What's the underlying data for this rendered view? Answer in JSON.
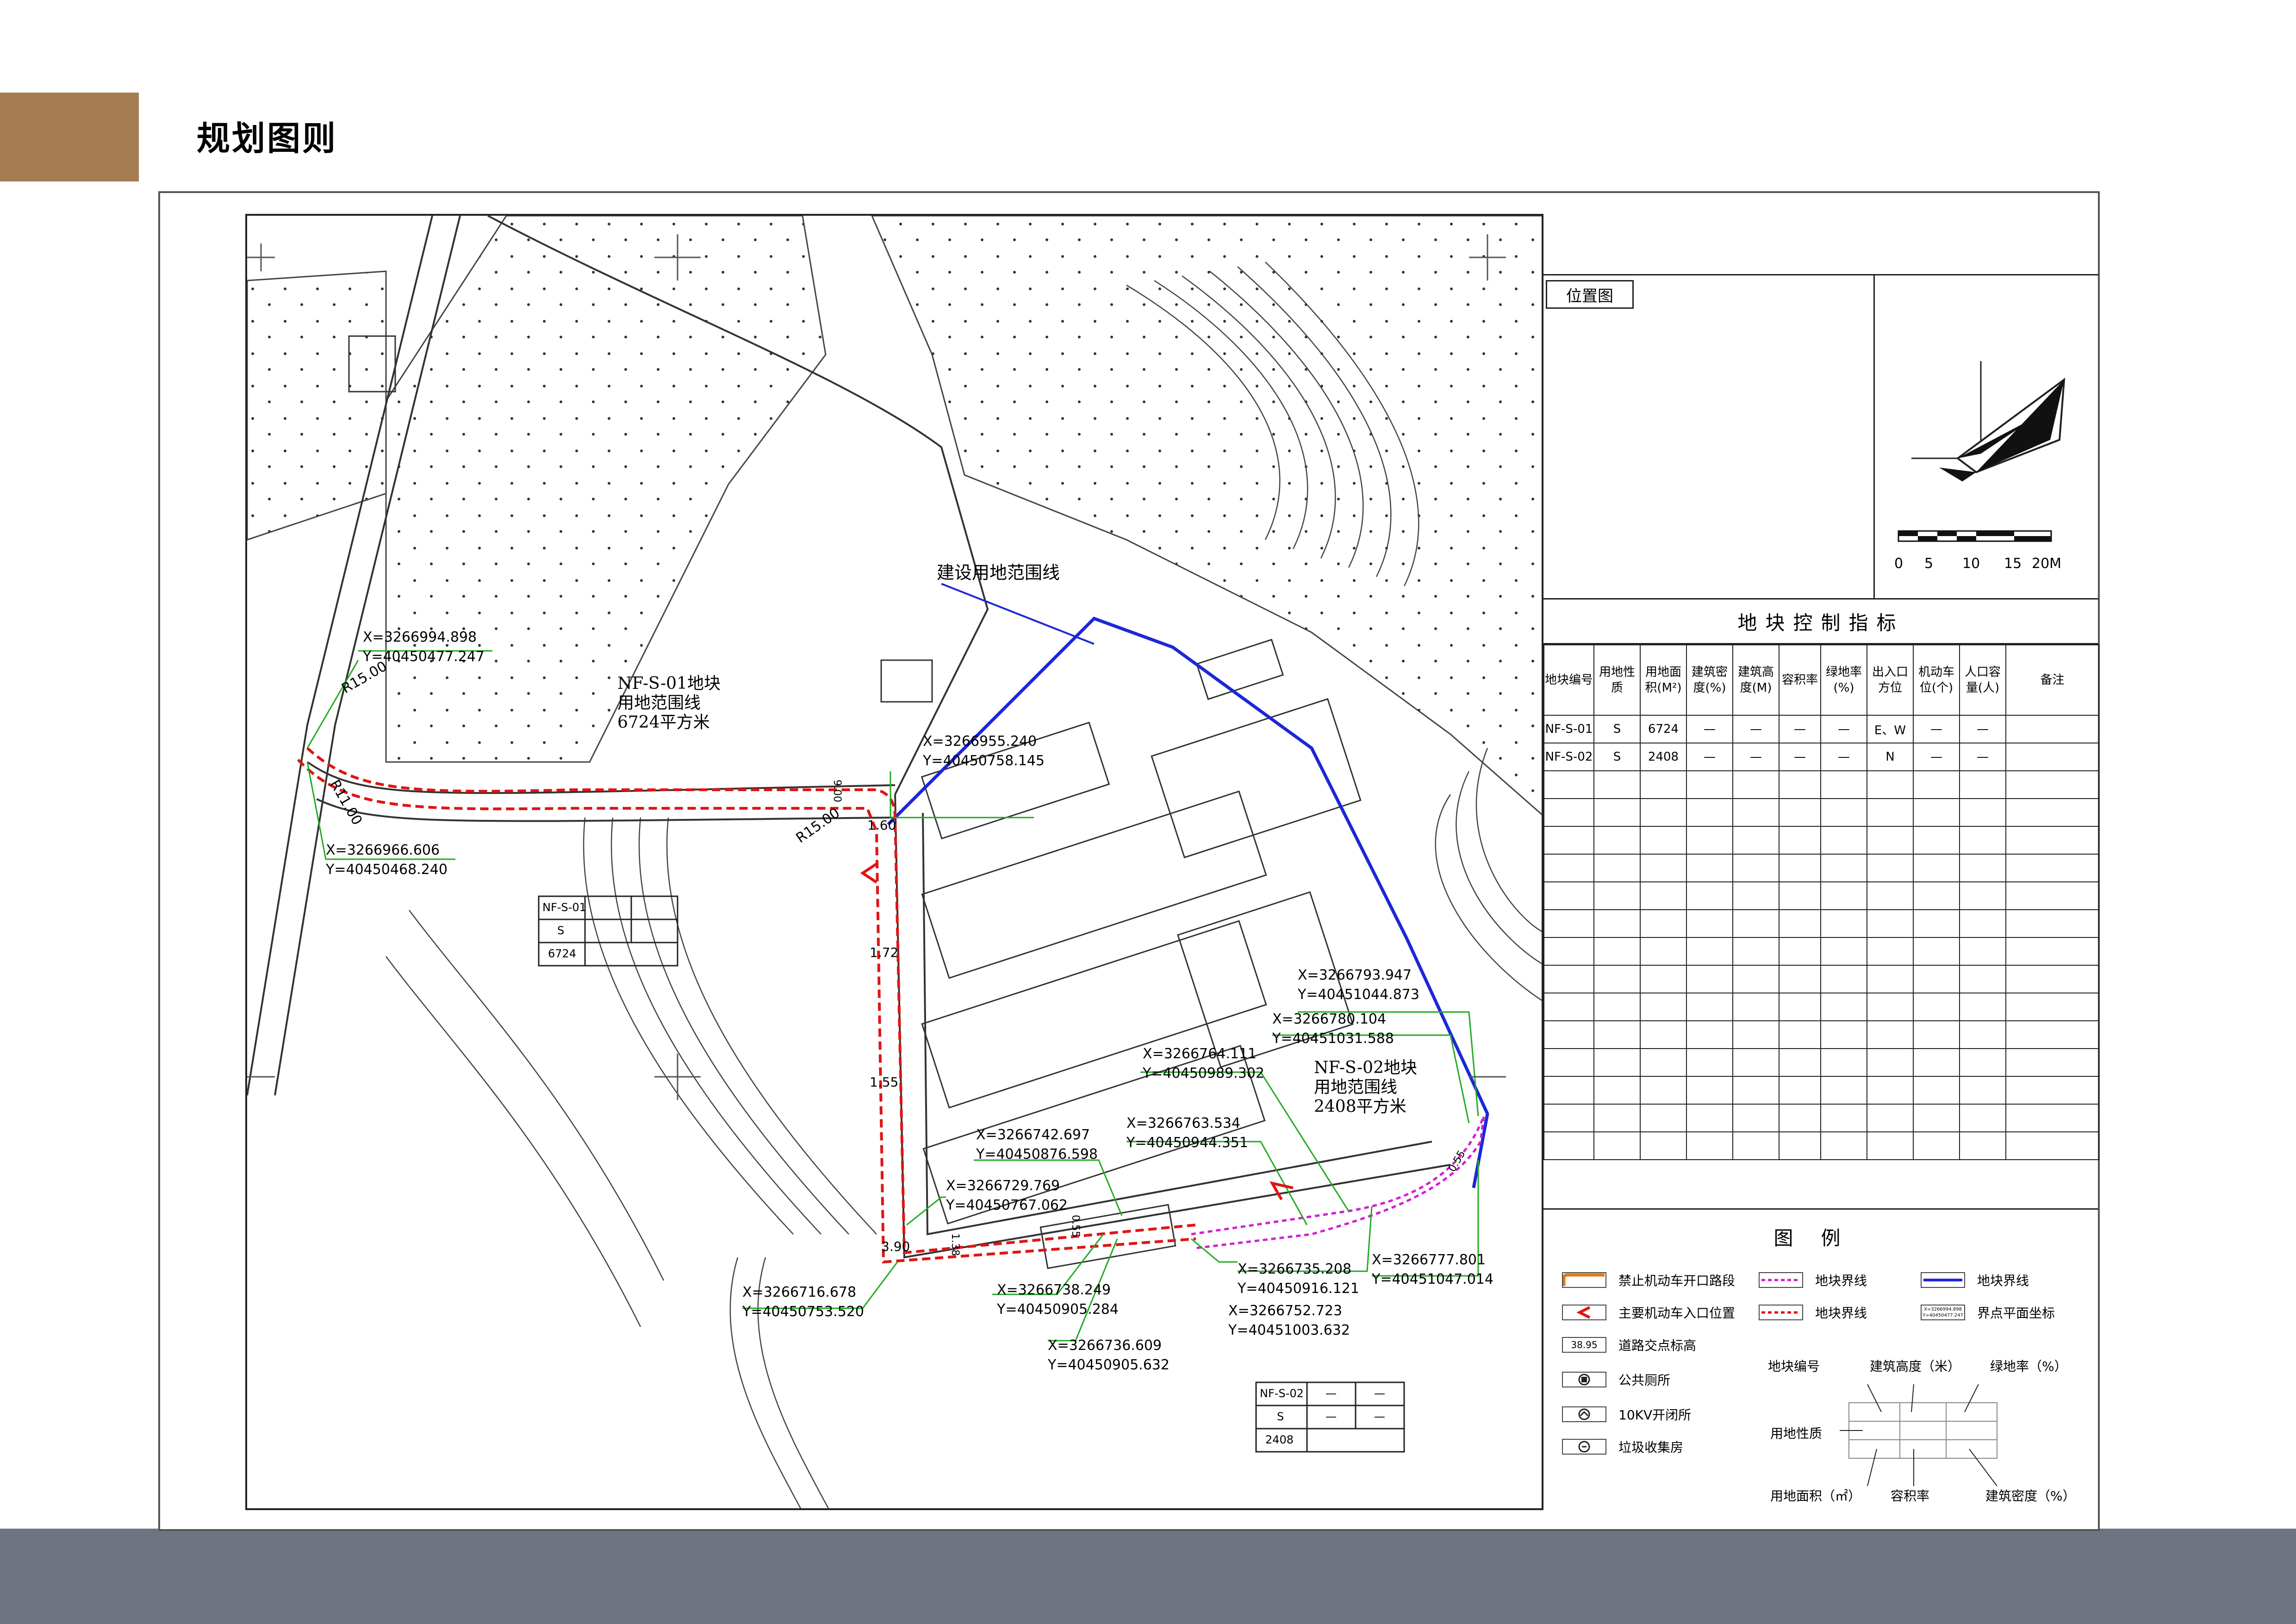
{
  "header": {
    "title": "规划图则"
  },
  "colors": {
    "brand": "#a57c52",
    "footer": "#6e7580",
    "boundary_blue": "#1c28d6",
    "boundary_red": "#e01414",
    "boundary_magenta": "#d020d0",
    "coord_green": "#22aa22"
  },
  "location_panel": {
    "label": "位置图",
    "scale_ticks": [
      "0",
      "5",
      "10",
      "15",
      "20M"
    ]
  },
  "control_table": {
    "title": "地块控制指标",
    "headers": [
      "地块编号",
      "用地性质",
      "用地面积(M²)",
      "建筑密度(%)",
      "建筑高度(M)",
      "容积率",
      "绿地率(%)",
      "出入口方位",
      "机动车位(个)",
      "人口容量(人)",
      "备注"
    ],
    "rows": [
      [
        "NF-S-01",
        "S",
        "6724",
        "—",
        "—",
        "—",
        "—",
        "E、W",
        "—",
        "—",
        ""
      ],
      [
        "NF-S-02",
        "S",
        "2408",
        "—",
        "—",
        "—",
        "—",
        "N",
        "—",
        "—",
        ""
      ]
    ],
    "empty_rows": 14
  },
  "legend": {
    "title": "图例",
    "items": {
      "no_entry": "禁止机动车开口路段",
      "main_entry": "主要机动车入口位置",
      "road_elev": "道路交点标高",
      "road_elev_sample": "38.95",
      "toilet": "公共厕所",
      "switch": "10KV开闭所",
      "garbage": "垃圾收集房",
      "plot_line_magenta": "地块界线",
      "plot_line_red": "地块界线",
      "plot_line_blue": "地块界线",
      "coord": "界点平面坐标",
      "coord_sample_x": "X=3266994.898",
      "coord_sample_y": "Y=40450477.247"
    },
    "key": {
      "plot_no": "地块编号",
      "height": "建筑高度（米）",
      "green": "绿地率（%）",
      "use": "用地性质",
      "area": "用地面积（㎡）",
      "far": "容积率",
      "density": "建筑密度（%）"
    }
  },
  "map": {
    "boundary_label_blue": "建设用地范围线",
    "plot1_label": [
      "NF-S-01地块",
      "用地范围线",
      "6724平方米"
    ],
    "plot2_label": [
      "NF-S-02地块",
      "用地范围线",
      "2408平方米"
    ],
    "radii": [
      "R15.00",
      "R11.00",
      "R15.00"
    ],
    "widths": [
      "1.60",
      "1.72",
      "1.55",
      "3.90",
      "1.38",
      "0.55",
      "0.55",
      "9.00"
    ],
    "coords": [
      [
        "X=3266994.898",
        "Y=40450477.247"
      ],
      [
        "X=3266966.606",
        "Y=40450468.240"
      ],
      [
        "X=3266955.240",
        "Y=40450758.145"
      ],
      [
        "X=3266793.947",
        "Y=40451044.873"
      ],
      [
        "X=3266780.104",
        "Y=40451031.588"
      ],
      [
        "X=3266764.111",
        "Y=40450989.302"
      ],
      [
        "X=3266763.534",
        "Y=40450944.351"
      ],
      [
        "X=3266742.697",
        "Y=40450876.598"
      ],
      [
        "X=3266729.769",
        "Y=40450767.062"
      ],
      [
        "X=3266716.678",
        "Y=40450753.520"
      ],
      [
        "X=3266738.249",
        "Y=40450905.284"
      ],
      [
        "X=3266736.609",
        "Y=40450905.632"
      ],
      [
        "X=3266735.208",
        "Y=40450916.121"
      ],
      [
        "X=3266752.723",
        "Y=40451003.632"
      ],
      [
        "X=3266777.801",
        "Y=40451047.014"
      ]
    ],
    "mini_table_1": [
      "NF-S-01",
      "S",
      "6724"
    ],
    "mini_table_2": [
      "NF-S-02",
      "—",
      "—",
      "S",
      "—",
      "—",
      "2408"
    ]
  }
}
